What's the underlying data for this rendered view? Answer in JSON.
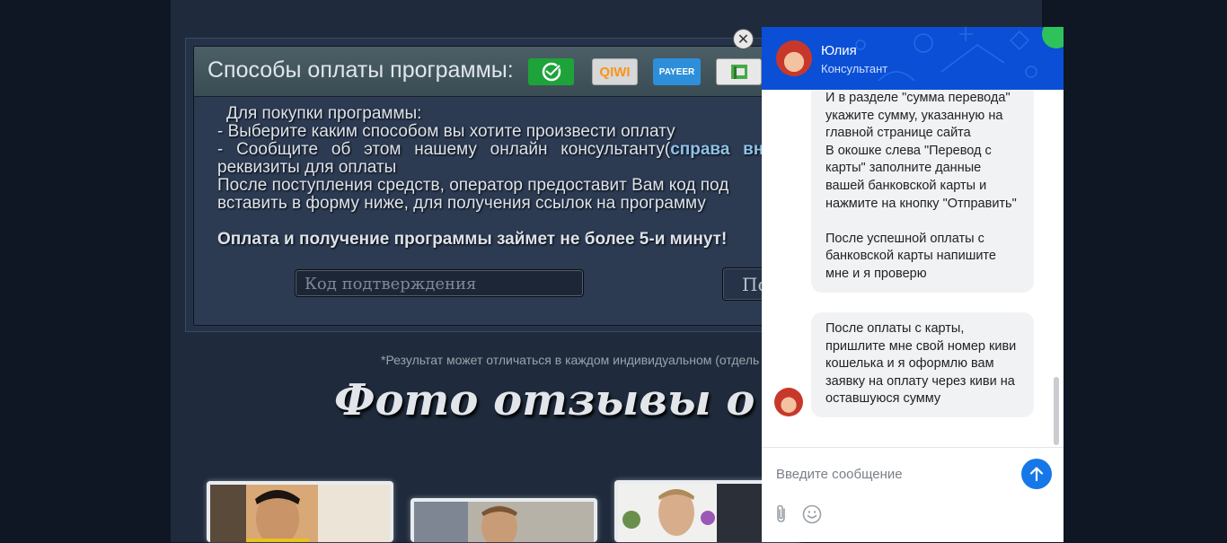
{
  "payment": {
    "title": "Способы оплаты программы:",
    "methods": [
      {
        "icon": "sberbank-logo-icon",
        "color": "#21a038"
      },
      {
        "label": "QIWI",
        "color": "#f7941d"
      },
      {
        "label": "PAYEER",
        "color": "#3b8fd6"
      },
      {
        "icon": "privatbank-logo-icon",
        "color": "#47a947"
      }
    ],
    "line1": "Для покупки программы:",
    "line2": "- Выберите каким способом вы хотите произвести оплату",
    "line3a": "- Сообщите об этом нашему онлайн консультанту(",
    "line3b": "справа вни",
    "line4": "реквизиты для оплаты",
    "line5": "После поступления средств, оператор предоставит Вам код под",
    "line6": "вставить в форму ниже, для получения ссылок на программу",
    "bold": "Оплата и получение программы займет не более 5-и минут!",
    "code_placeholder": "Код подтверждения",
    "button": "По"
  },
  "close_symbol": "✕",
  "disclaimer": "*Результат может отличаться в каждом индивидуальном (отдель",
  "reviews_title": "Фото отзывы о прогр",
  "chat": {
    "agent_name": "Юлия",
    "agent_role": "Консультант",
    "message1": "И в разделе \"сумма перевода\" укажите сумму, указанную на главной странице сайта\nВ окошке слева \"Перевод с карты\" заполните данные вашей банковской карты и нажмите на кнопку \"Отправить\"\n\nПосле успешной оплаты с банковской карты напишите мне и я проверю",
    "message2": "После оплаты с карты, пришлите мне свой номер киви кошелька и я оформлю вам заявку на оплату через киви на оставшуюся сумму",
    "input_placeholder": "Введите сообщение",
    "send_icon": "arrow-up-icon",
    "attach_icon": "paperclip-icon",
    "emoji_icon": "smiley-icon",
    "accent": "#0a4fd6"
  }
}
